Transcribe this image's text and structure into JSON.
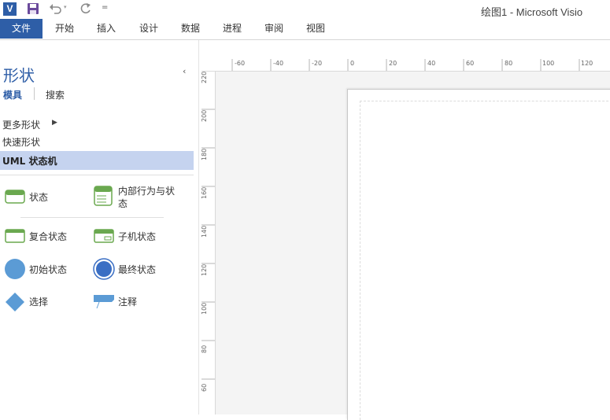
{
  "window": {
    "title": "绘图1 - Microsoft Visio",
    "logo_text": "V",
    "qat": {
      "save": "save-icon",
      "undo": "undo-icon",
      "redo": "redo-icon",
      "customize": "customize-icon",
      "more_glyph": "=",
      "undo_arrow": "▾"
    }
  },
  "ribbon": {
    "tabs": [
      {
        "label": "文件",
        "active": true
      },
      {
        "label": "开始"
      },
      {
        "label": "插入"
      },
      {
        "label": "设计"
      },
      {
        "label": "数据"
      },
      {
        "label": "进程"
      },
      {
        "label": "审阅"
      },
      {
        "label": "视图"
      }
    ]
  },
  "shapes_pane": {
    "title": "形状",
    "collapse_glyph": "‹",
    "tabs": {
      "stencils": "模具",
      "search": "搜索"
    },
    "more_shapes": "更多形状",
    "more_arrow": "▶",
    "quick_shapes": "快速形状",
    "stencil": "UML 状态机",
    "shapes": [
      {
        "label": "状态",
        "icon": "state-icon"
      },
      {
        "label": "内部行为与状态",
        "icon": "internal-behavior-icon"
      },
      {
        "label": "复合状态",
        "icon": "composite-state-icon"
      },
      {
        "label": "子机状态",
        "icon": "submachine-state-icon"
      },
      {
        "label": "初始状态",
        "icon": "initial-state-icon"
      },
      {
        "label": "最终状态",
        "icon": "final-state-icon"
      },
      {
        "label": "选择",
        "icon": "choice-icon"
      },
      {
        "label": "注释",
        "icon": "note-icon"
      }
    ]
  },
  "rulers": {
    "horizontal": [
      "-60",
      "-40",
      "-20",
      "0",
      "20",
      "40",
      "60",
      "80",
      "100",
      "120"
    ],
    "vertical": [
      "220",
      "200",
      "180",
      "160",
      "140",
      "120",
      "100",
      "80",
      "60"
    ]
  },
  "colors": {
    "accent": "#2e5ea7",
    "shape_green": "#6aa84f",
    "shape_blue": "#5b9bd5",
    "selected": "#c5d3ef"
  }
}
